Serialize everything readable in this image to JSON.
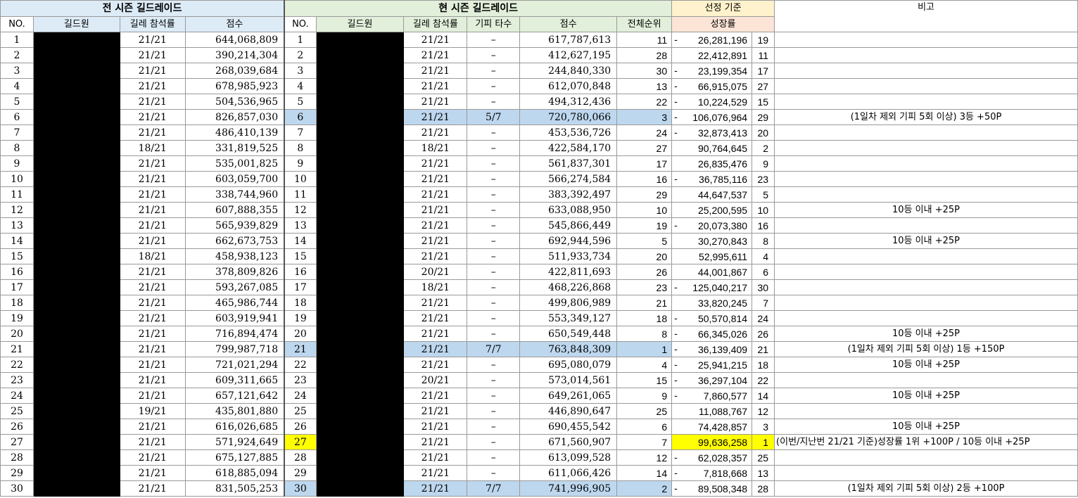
{
  "headers": {
    "prev_season": "전 시즌 길드레이드",
    "curr_season": "현 시즌 길드레이드",
    "selection": "선정 기준",
    "remarks": "비고",
    "no": "NO.",
    "member": "길드원",
    "attendance": "길레 참석률",
    "score": "점수",
    "boss_hits": "기피 타수",
    "overall_rank": "전체순위",
    "growth": "성장률"
  },
  "rows": [
    {
      "no": "1",
      "prev_att": "21/21",
      "prev_score": "644,068,809",
      "att": "21/21",
      "boss": "–",
      "score": "617,787,613",
      "rank": "11",
      "neg": "-",
      "growth": "26,281,196",
      "grank": "19",
      "note": ""
    },
    {
      "no": "2",
      "prev_att": "21/21",
      "prev_score": "390,214,304",
      "att": "21/21",
      "boss": "–",
      "score": "412,627,195",
      "rank": "28",
      "neg": "",
      "growth": "22,412,891",
      "grank": "11",
      "note": ""
    },
    {
      "no": "3",
      "prev_att": "21/21",
      "prev_score": "268,039,684",
      "att": "21/21",
      "boss": "–",
      "score": "244,840,330",
      "rank": "30",
      "neg": "-",
      "growth": "23,199,354",
      "grank": "17",
      "note": ""
    },
    {
      "no": "4",
      "prev_att": "21/21",
      "prev_score": "678,985,923",
      "att": "21/21",
      "boss": "–",
      "score": "612,070,848",
      "rank": "13",
      "neg": "-",
      "growth": "66,915,075",
      "grank": "27",
      "note": ""
    },
    {
      "no": "5",
      "prev_att": "21/21",
      "prev_score": "504,536,965",
      "att": "21/21",
      "boss": "–",
      "score": "494,312,436",
      "rank": "22",
      "neg": "-",
      "growth": "10,224,529",
      "grank": "15",
      "note": ""
    },
    {
      "no": "6",
      "prev_att": "21/21",
      "prev_score": "826,857,030",
      "att": "21/21",
      "boss": "5/7",
      "score": "720,780,066",
      "rank": "3",
      "neg": "-",
      "growth": "106,076,964",
      "grank": "29",
      "note": "(1일차 제외 기피 5회 이상) 3등 +50P",
      "hl": true
    },
    {
      "no": "7",
      "prev_att": "21/21",
      "prev_score": "486,410,139",
      "att": "21/21",
      "boss": "–",
      "score": "453,536,726",
      "rank": "24",
      "neg": "-",
      "growth": "32,873,413",
      "grank": "20",
      "note": ""
    },
    {
      "no": "8",
      "prev_att": "18/21",
      "prev_score": "331,819,525",
      "att": "18/21",
      "boss": "–",
      "score": "422,584,170",
      "rank": "27",
      "neg": "",
      "growth": "90,764,645",
      "grank": "2",
      "note": ""
    },
    {
      "no": "9",
      "prev_att": "21/21",
      "prev_score": "535,001,825",
      "att": "21/21",
      "boss": "–",
      "score": "561,837,301",
      "rank": "17",
      "neg": "",
      "growth": "26,835,476",
      "grank": "9",
      "note": ""
    },
    {
      "no": "10",
      "prev_att": "21/21",
      "prev_score": "603,059,700",
      "att": "21/21",
      "boss": "–",
      "score": "566,274,584",
      "rank": "16",
      "neg": "-",
      "growth": "36,785,116",
      "grank": "23",
      "note": ""
    },
    {
      "no": "11",
      "prev_att": "21/21",
      "prev_score": "338,744,960",
      "att": "21/21",
      "boss": "–",
      "score": "383,392,497",
      "rank": "29",
      "neg": "",
      "growth": "44,647,537",
      "grank": "5",
      "note": ""
    },
    {
      "no": "12",
      "prev_att": "21/21",
      "prev_score": "607,888,355",
      "att": "21/21",
      "boss": "–",
      "score": "633,088,950",
      "rank": "10",
      "neg": "",
      "growth": "25,200,595",
      "grank": "10",
      "note": "10등 이내 +25P"
    },
    {
      "no": "13",
      "prev_att": "21/21",
      "prev_score": "565,939,829",
      "att": "21/21",
      "boss": "–",
      "score": "545,866,449",
      "rank": "19",
      "neg": "-",
      "growth": "20,073,380",
      "grank": "16",
      "note": ""
    },
    {
      "no": "14",
      "prev_att": "21/21",
      "prev_score": "662,673,753",
      "att": "21/21",
      "boss": "–",
      "score": "692,944,596",
      "rank": "5",
      "neg": "",
      "growth": "30,270,843",
      "grank": "8",
      "note": "10등 이내 +25P"
    },
    {
      "no": "15",
      "prev_att": "18/21",
      "prev_score": "458,938,123",
      "att": "21/21",
      "boss": "–",
      "score": "511,933,734",
      "rank": "20",
      "neg": "",
      "growth": "52,995,611",
      "grank": "4",
      "note": ""
    },
    {
      "no": "16",
      "prev_att": "21/21",
      "prev_score": "378,809,826",
      "att": "20/21",
      "boss": "–",
      "score": "422,811,693",
      "rank": "26",
      "neg": "",
      "growth": "44,001,867",
      "grank": "6",
      "note": ""
    },
    {
      "no": "17",
      "prev_att": "21/21",
      "prev_score": "593,267,085",
      "att": "18/21",
      "boss": "–",
      "score": "468,226,868",
      "rank": "23",
      "neg": "-",
      "growth": "125,040,217",
      "grank": "30",
      "note": ""
    },
    {
      "no": "18",
      "prev_att": "21/21",
      "prev_score": "465,986,744",
      "att": "21/21",
      "boss": "–",
      "score": "499,806,989",
      "rank": "21",
      "neg": "",
      "growth": "33,820,245",
      "grank": "7",
      "note": ""
    },
    {
      "no": "19",
      "prev_att": "21/21",
      "prev_score": "603,919,941",
      "att": "21/21",
      "boss": "–",
      "score": "553,349,127",
      "rank": "18",
      "neg": "-",
      "growth": "50,570,814",
      "grank": "24",
      "note": ""
    },
    {
      "no": "20",
      "prev_att": "21/21",
      "prev_score": "716,894,474",
      "att": "21/21",
      "boss": "–",
      "score": "650,549,448",
      "rank": "8",
      "neg": "-",
      "growth": "66,345,026",
      "grank": "26",
      "note": "10등 이내 +25P"
    },
    {
      "no": "21",
      "prev_att": "21/21",
      "prev_score": "799,987,718",
      "att": "21/21",
      "boss": "7/7",
      "score": "763,848,309",
      "rank": "1",
      "neg": "-",
      "growth": "36,139,409",
      "grank": "21",
      "note": "(1일차 제외 기피 5회 이상) 1등 +150P",
      "hl": true
    },
    {
      "no": "22",
      "prev_att": "21/21",
      "prev_score": "721,021,294",
      "att": "21/21",
      "boss": "–",
      "score": "695,080,079",
      "rank": "4",
      "neg": "-",
      "growth": "25,941,215",
      "grank": "18",
      "note": "10등 이내 +25P"
    },
    {
      "no": "23",
      "prev_att": "21/21",
      "prev_score": "609,311,665",
      "att": "20/21",
      "boss": "–",
      "score": "573,014,561",
      "rank": "15",
      "neg": "-",
      "growth": "36,297,104",
      "grank": "22",
      "note": ""
    },
    {
      "no": "24",
      "prev_att": "21/21",
      "prev_score": "657,121,642",
      "att": "21/21",
      "boss": "–",
      "score": "649,261,065",
      "rank": "9",
      "neg": "-",
      "growth": "7,860,577",
      "grank": "14",
      "note": "10등 이내 +25P"
    },
    {
      "no": "25",
      "prev_att": "19/21",
      "prev_score": "435,801,880",
      "att": "21/21",
      "boss": "–",
      "score": "446,890,647",
      "rank": "25",
      "neg": "",
      "growth": "11,088,767",
      "grank": "12",
      "note": ""
    },
    {
      "no": "26",
      "prev_att": "21/21",
      "prev_score": "616,026,685",
      "att": "21/21",
      "boss": "–",
      "score": "690,455,542",
      "rank": "6",
      "neg": "",
      "growth": "74,428,857",
      "grank": "3",
      "note": "10등 이내 +25P"
    },
    {
      "no": "27",
      "prev_att": "21/21",
      "prev_score": "571,924,649",
      "att": "21/21",
      "boss": "–",
      "score": "671,560,907",
      "rank": "7",
      "neg": "",
      "growth": "99,636,258",
      "grank": "1",
      "note": "(이번/지난번 21/21 기준)성장률 1위 +100P / 10등 이내 +25P",
      "yellow": true
    },
    {
      "no": "28",
      "prev_att": "21/21",
      "prev_score": "675,127,885",
      "att": "21/21",
      "boss": "–",
      "score": "613,099,528",
      "rank": "12",
      "neg": "-",
      "growth": "62,028,357",
      "grank": "25",
      "note": ""
    },
    {
      "no": "29",
      "prev_att": "21/21",
      "prev_score": "618,885,094",
      "att": "21/21",
      "boss": "–",
      "score": "611,066,426",
      "rank": "14",
      "neg": "-",
      "growth": "7,818,668",
      "grank": "13",
      "note": ""
    },
    {
      "no": "30",
      "prev_att": "21/21",
      "prev_score": "831,505,253",
      "att": "21/21",
      "boss": "7/7",
      "score": "741,996,905",
      "rank": "2",
      "neg": "-",
      "growth": "89,508,348",
      "grank": "28",
      "note": "(1일차 제외 기피 5회 이상) 2등 +100P",
      "hl": true
    }
  ]
}
